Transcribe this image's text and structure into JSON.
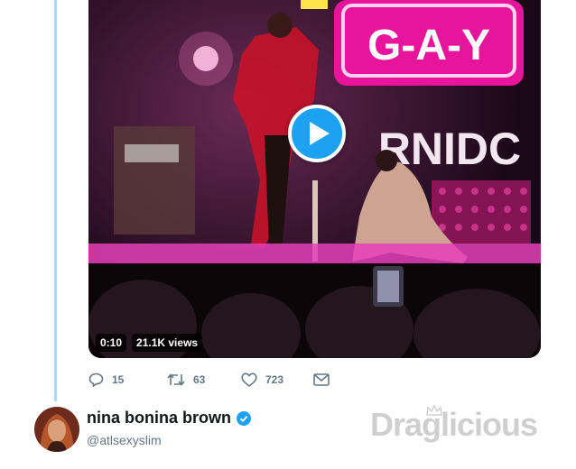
{
  "video": {
    "sign_text": "G-A-Y",
    "sign_text_2": "RNIDC",
    "duration": "0:10",
    "views": "21.1K views"
  },
  "actions": {
    "replies": "15",
    "retweets": "63",
    "likes": "723"
  },
  "author": {
    "name": "nina bonina brown",
    "handle": "@atlsexyslim",
    "verified": true
  },
  "watermark": "Draglicious",
  "colors": {
    "accent": "#1da1f2",
    "thread_line": "#aed8f7",
    "meta_text": "#657786",
    "sign_magenta": "#e8149c"
  },
  "icons": [
    "reply-icon",
    "retweet-icon",
    "like-icon",
    "message-icon",
    "play-icon",
    "verified-badge-icon"
  ]
}
